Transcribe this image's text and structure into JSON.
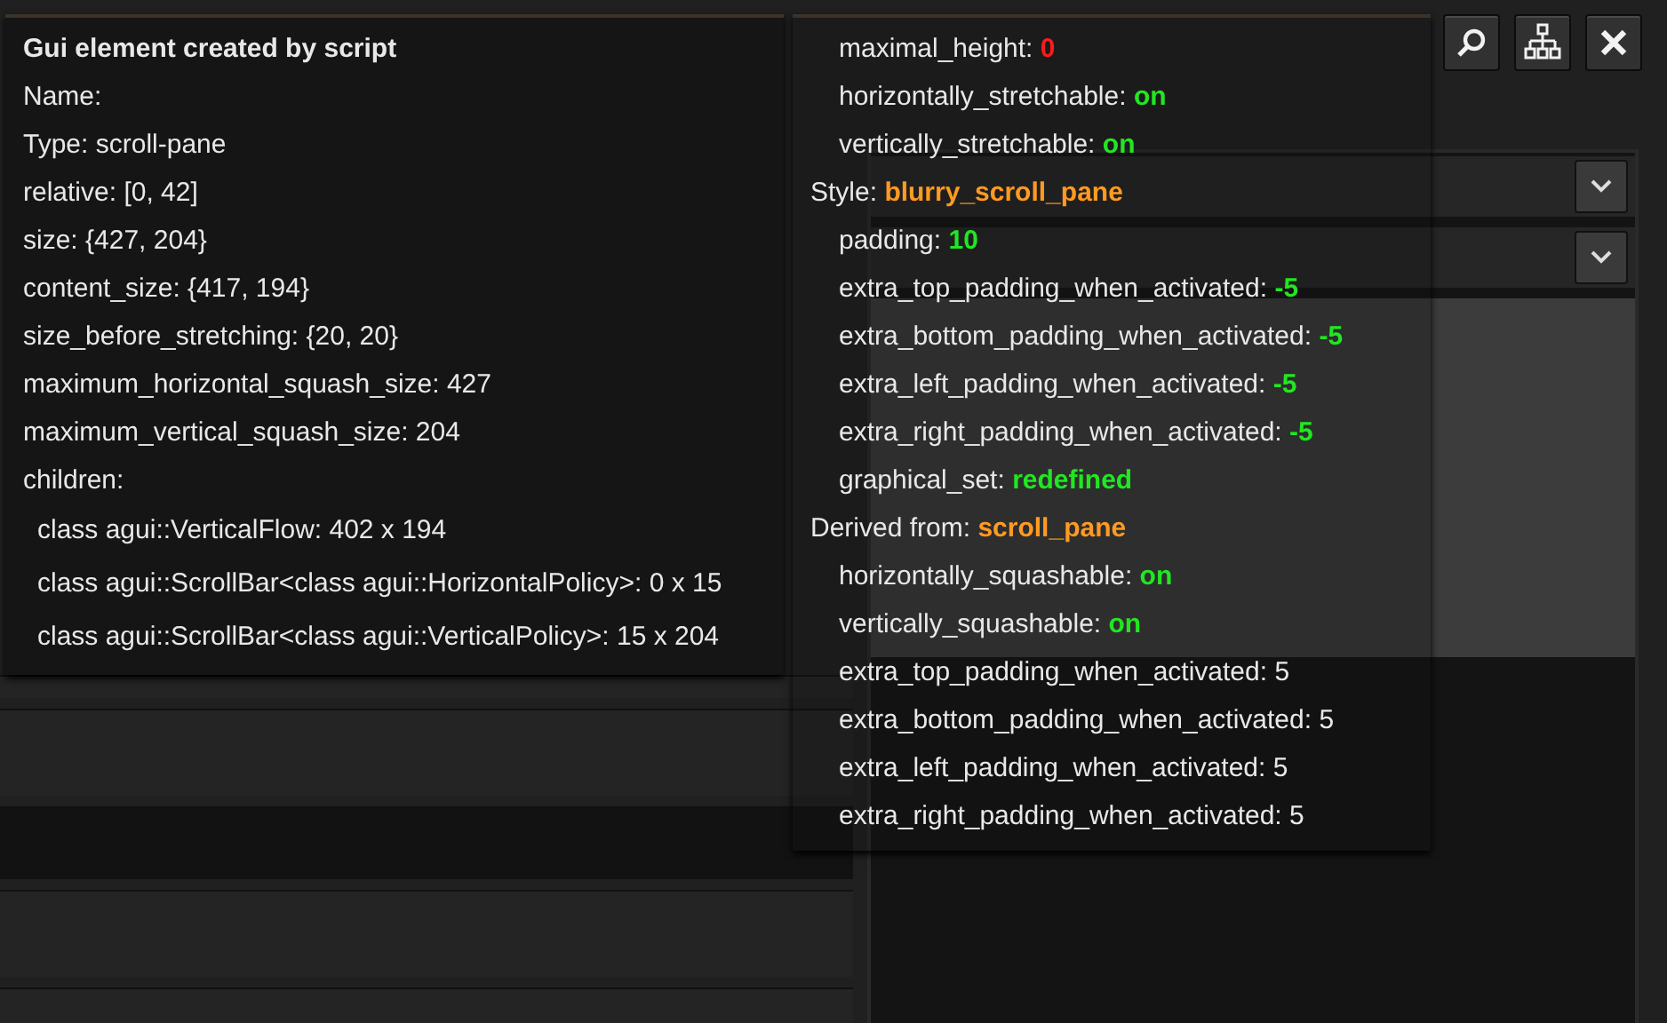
{
  "left_tooltip": {
    "title": "Gui element created by script",
    "lines": [
      "Name:",
      "Type: scroll-pane",
      "relative: [0, 42]",
      "size: {427, 204}",
      "content_size: {417, 194}",
      "size_before_stretching: {20, 20}",
      "maximum_horizontal_squash_size: 427",
      "maximum_vertical_squash_size: 204"
    ],
    "children_label": "children:",
    "children": [
      "class agui::VerticalFlow: 402 x 194",
      "class agui::ScrollBar<class agui::HorizontalPolicy>: 0 x 15",
      "class agui::ScrollBar<class agui::VerticalPolicy>: 15 x 204"
    ]
  },
  "right_tooltip": {
    "leading_properties": [
      {
        "name": "maximal_height:",
        "value": "0",
        "color": "#ff1a1a"
      },
      {
        "name": "horizontally_stretchable:",
        "value": "on",
        "color": "#22e622"
      },
      {
        "name": "vertically_stretchable:",
        "value": "on",
        "color": "#22e622"
      }
    ],
    "sections": [
      {
        "label": "Style:",
        "value": "blurry_scroll_pane",
        "color": "#ff9a22",
        "properties": [
          {
            "name": "padding:",
            "value": "10",
            "color": "#22e622"
          },
          {
            "name": "extra_top_padding_when_activated:",
            "value": "-5",
            "color": "#22e622"
          },
          {
            "name": "extra_bottom_padding_when_activated:",
            "value": "-5",
            "color": "#22e622"
          },
          {
            "name": "extra_left_padding_when_activated:",
            "value": "-5",
            "color": "#22e622"
          },
          {
            "name": "extra_right_padding_when_activated:",
            "value": "-5",
            "color": "#22e622"
          },
          {
            "name": "graphical_set:",
            "value": "redefined",
            "color": "#22e622"
          }
        ]
      },
      {
        "label": "Derived from:",
        "value": "scroll_pane",
        "color": "#ff9a22",
        "properties": [
          {
            "name": "horizontally_squashable:",
            "value": "on",
            "color": "#22e622"
          },
          {
            "name": "vertically_squashable:",
            "value": "on",
            "color": "#22e622"
          },
          {
            "name": "extra_top_padding_when_activated:",
            "value": "5"
          },
          {
            "name": "extra_bottom_padding_when_activated:",
            "value": "5"
          },
          {
            "name": "extra_left_padding_when_activated:",
            "value": "5"
          },
          {
            "name": "extra_right_padding_when_activated:",
            "value": "5"
          }
        ]
      }
    ]
  }
}
